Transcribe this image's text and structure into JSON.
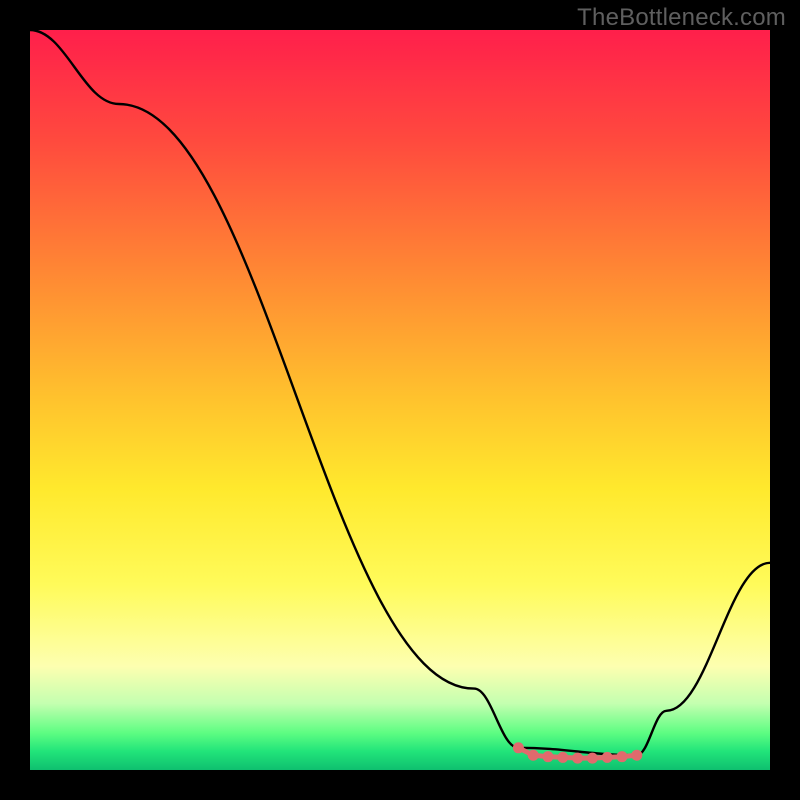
{
  "watermark": "TheBottleneck.com",
  "chart_data": {
    "type": "line",
    "title": "",
    "xlabel": "",
    "ylabel": "",
    "xlim": [
      0,
      100
    ],
    "ylim": [
      0,
      100
    ],
    "series": [
      {
        "name": "bottleneck-curve",
        "x": [
          0,
          12,
          60,
          66,
          82,
          86,
          100
        ],
        "values": [
          100,
          90,
          11,
          3,
          2,
          8,
          28
        ],
        "color": "#000000"
      },
      {
        "name": "optimal-band",
        "type": "scatter",
        "x": [
          66,
          68,
          70,
          72,
          74,
          76,
          78,
          80,
          82
        ],
        "values": [
          3,
          2,
          1.8,
          1.7,
          1.6,
          1.6,
          1.7,
          1.8,
          2
        ],
        "color": "#e16a6d"
      }
    ],
    "gradient_stops": [
      {
        "pos": 0.0,
        "color": "#ff1f4b"
      },
      {
        "pos": 0.15,
        "color": "#ff4a3e"
      },
      {
        "pos": 0.32,
        "color": "#ff8534"
      },
      {
        "pos": 0.5,
        "color": "#ffc32d"
      },
      {
        "pos": 0.62,
        "color": "#ffe92d"
      },
      {
        "pos": 0.75,
        "color": "#fffb5a"
      },
      {
        "pos": 0.86,
        "color": "#fdffb0"
      },
      {
        "pos": 0.91,
        "color": "#c4ffb0"
      },
      {
        "pos": 0.95,
        "color": "#5dfd82"
      },
      {
        "pos": 0.975,
        "color": "#21e47a"
      },
      {
        "pos": 1.0,
        "color": "#0fbf6f"
      }
    ]
  }
}
